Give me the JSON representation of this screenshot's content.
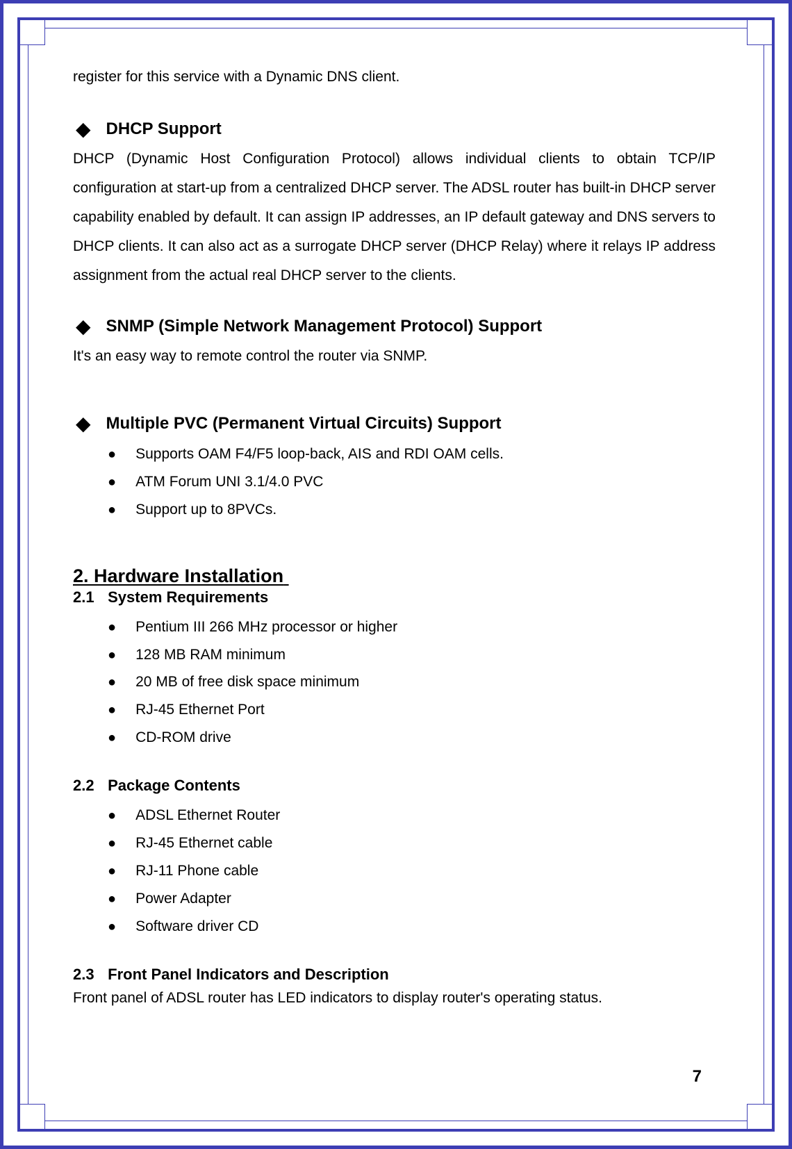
{
  "carryover": "register for this service with a Dynamic DNS client.",
  "features": [
    {
      "title": "DHCP Support",
      "body": "DHCP (Dynamic Host Configuration Protocol) allows individual clients to obtain TCP/IP configuration at start-up from a centralized DHCP server. The ADSL router has built-in DHCP server capability enabled by default. It can assign IP addresses, an IP default gateway and DNS servers to DHCP clients. It can also act as a surrogate DHCP server (DHCP Relay) where it relays IP address assignment from the actual real DHCP server to the clients."
    },
    {
      "title": "SNMP (Simple Network Management Protocol) Support",
      "body": "It's an easy way to remote control the router via SNMP."
    },
    {
      "title": "Multiple PVC (Permanent Virtual Circuits) Support",
      "bullets": [
        "Supports OAM F4/F5 loop-back, AIS and RDI OAM cells.",
        "ATM Forum UNI 3.1/4.0 PVC",
        "Support up to 8PVCs."
      ]
    }
  ],
  "section2": {
    "title": "2. Hardware Installation",
    "sub1": {
      "num": "2.1",
      "label": "System Requirements"
    },
    "req_bullets": [
      "Pentium III 266 MHz processor or higher",
      "128 MB RAM minimum",
      "20 MB of free disk space minimum",
      "RJ-45 Ethernet Port",
      "CD-ROM drive"
    ],
    "sub2": {
      "num": "2.2",
      "label": "Package Contents"
    },
    "pkg_bullets": [
      "ADSL Ethernet Router",
      "RJ-45 Ethernet cable",
      "RJ-11 Phone cable",
      "Power Adapter",
      "Software driver CD"
    ],
    "sub3": {
      "num": "2.3",
      "label": "Front Panel Indicators and Description"
    },
    "sub3_body": "Front panel of ADSL router has LED indicators to display router's operating status."
  },
  "page_number": "7"
}
